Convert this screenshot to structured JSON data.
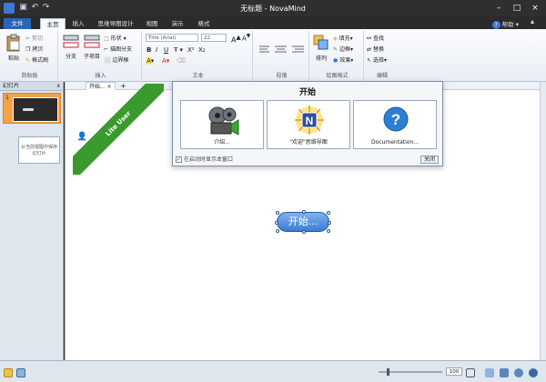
{
  "window": {
    "title": "无标题 - NovaMind"
  },
  "ribbon_tabs": [
    {
      "label": "文件"
    },
    {
      "label": "主页"
    },
    {
      "label": "插入"
    },
    {
      "label": "思维导图设计"
    },
    {
      "label": "视图"
    },
    {
      "label": "演示"
    },
    {
      "label": "格式"
    }
  ],
  "help_label": "帮助",
  "clipboard": {
    "paste": "粘贴",
    "cut": "剪切",
    "copy": "拷贝",
    "format_painter": "格式刷",
    "label": "剪贴板"
  },
  "insert": {
    "branch": "分支",
    "subitem": "子项目",
    "shape": "形状",
    "relation": "描图分支",
    "boundary": "边界框",
    "label": "插入"
  },
  "text": {
    "font": "Title (Arial)",
    "size": "22",
    "label": "文本"
  },
  "paragraph": {
    "label": "段落"
  },
  "drawing": {
    "arrange": "排列",
    "fill": "填充",
    "border": "边框",
    "effects": "效果",
    "label": "绘图格式"
  },
  "editing": {
    "find": "查找",
    "replace": "替换",
    "select": "选择",
    "label": "编辑"
  },
  "left_panel": {
    "title": "幻灯片",
    "close": "x",
    "slide_number": "1",
    "add_slide_hint": "从当前视图中保存幻灯片"
  },
  "doc_tab": {
    "label": "开始...",
    "close": "×",
    "add": "+"
  },
  "lite_banner": "Lite User",
  "start_dialog": {
    "title": "开始",
    "cards": [
      {
        "label": "介绍..."
      },
      {
        "label": "\"欢迎\"思维导图"
      },
      {
        "label": "Documentation..."
      }
    ],
    "checkbox_label": "在启动时显示本窗口",
    "checkbox_checked": true,
    "close_label": "关闭"
  },
  "topic": {
    "label": "开始..."
  },
  "status": {
    "zoom_value": "100"
  }
}
